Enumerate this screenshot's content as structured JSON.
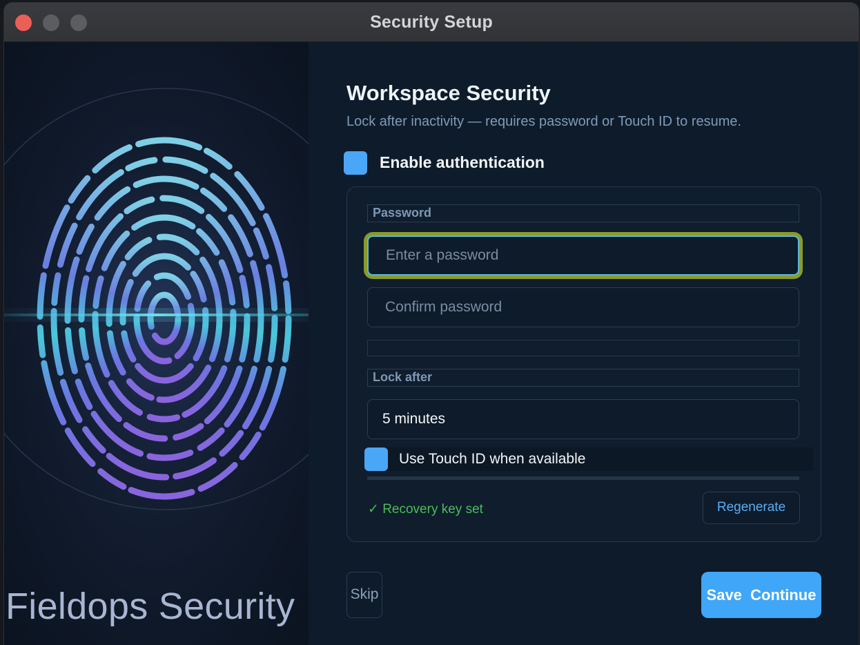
{
  "window": {
    "title": "Security Setup"
  },
  "hero": {
    "brand_text": "Fieldops Security"
  },
  "form": {
    "heading": "Workspace Security",
    "subheading": "Lock after inactivity — requires password or Touch ID to resume.",
    "enable_auth": {
      "label": "Enable authentication",
      "checked": true
    },
    "password": {
      "section_label": "Password",
      "placeholder": "Enter a password",
      "value": ""
    },
    "confirm": {
      "placeholder": "Confirm password",
      "value": ""
    },
    "lock_after": {
      "section_label": "Lock after",
      "selected": "5 minutes"
    },
    "touch_id": {
      "label": "Use Touch ID when available",
      "checked": true
    },
    "recovery": {
      "status": "✓ Recovery key set",
      "regenerate_label": "Regenerate"
    },
    "actions": {
      "skip_label": "Skip",
      "save_label": "Save  Continue"
    }
  },
  "colors": {
    "accent": "#40a6f8",
    "success": "#4bbd5a",
    "focus_ring": "#8a9a2d"
  }
}
